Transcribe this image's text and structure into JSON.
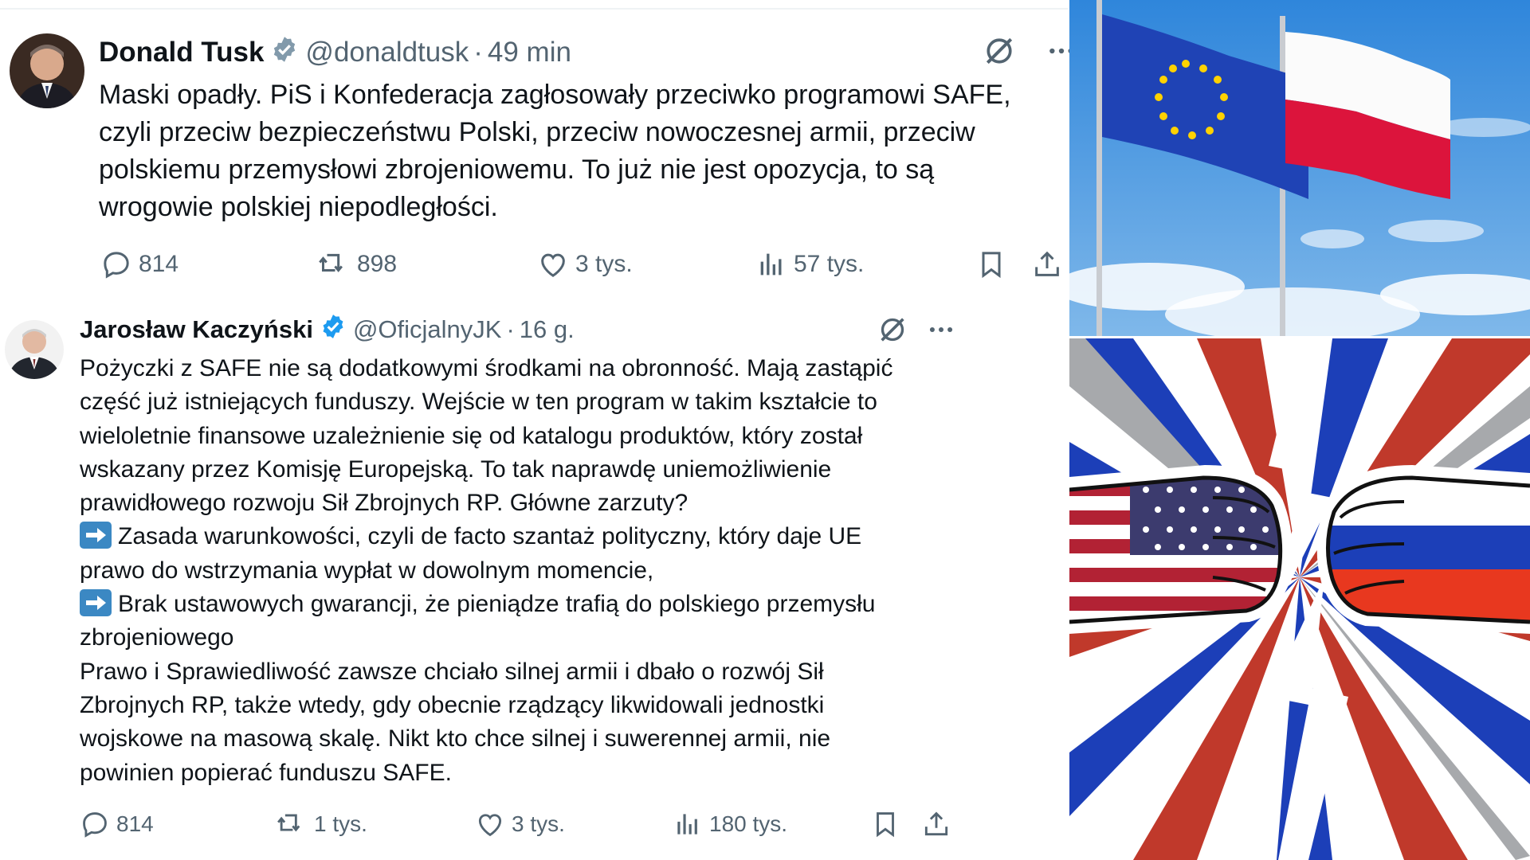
{
  "tweets": [
    {
      "author": "Donald Tusk",
      "handle": "@donaldtusk",
      "separator": "·",
      "time": "49 min",
      "text": "Maski opadły. PiS i Konfederacja zagłosowały przeciwko programowi SAFE,\nczyli przeciw bezpieczeństwu Polski, przeciw nowoczesnej armii, przeciw\npolskiemu przemysłowi zbrojeniowemu. To już nie jest opozycja, to są\nwrogowie polskiej niepodległości.",
      "replies": "814",
      "reposts": "898",
      "likes": "3 tys.",
      "views": "57 tys."
    },
    {
      "author": "Jarosław Kaczyński",
      "handle": "@OficjalnyJK",
      "separator": "·",
      "time": "16 g.",
      "text_lines": [
        "Pożyczki z SAFE nie są dodatkowymi środkami na obronność. Mają zastąpić",
        "część już istniejących funduszy. Wejście w ten program w takim kształcie to",
        "wieloletnie finansowe uzależnienie się od katalogu produktów, który został",
        "wskazany przez Komisję Europejską. To tak naprawdę uniemożliwienie",
        "prawidłowego rozwoju Sił Zbrojnych RP. Główne zarzuty?"
      ],
      "bullet1_line1": "Zasada warunkowości, czyli de facto szantaż polityczny, który daje UE",
      "bullet1_line2": "prawo do wstrzymania wypłat w dowolnym momencie,",
      "bullet2_line1": "Brak ustawowych gwarancji, że pieniądze trafią do polskiego przemysłu",
      "bullet2_line2": "zbrojeniowego",
      "closing_lines": [
        "Prawo i Sprawiedliwość zawsze chciało silnej armii i dbało o rozwój Sił",
        "Zbrojnych RP, także wtedy, gdy obecnie rządzący likwidowali jednostki",
        "wojskowe na masową skalę. Nikt kto chce silnej i suwerennej armii, nie",
        "powinien popierać funduszu SAFE."
      ],
      "replies": "814",
      "reposts": "1 tys.",
      "likes": "3 tys.",
      "views": "180 tys."
    }
  ],
  "icons": {
    "verified": "verified-badge-icon",
    "grok": "grok-icon",
    "more": "more-icon",
    "reply": "reply-icon",
    "repost": "repost-icon",
    "like": "like-icon",
    "views": "views-icon",
    "bookmark": "bookmark-icon",
    "share": "share-icon",
    "bullet": "arrow-right-emoji"
  },
  "colors": {
    "text": "#0f1419",
    "muted": "#536471",
    "verified": "#1d9bf0",
    "eu_blue": "#1f43b5",
    "poland_red": "#dc143c",
    "usa_red": "#b22234",
    "russia_blue": "#1c3fb8"
  }
}
